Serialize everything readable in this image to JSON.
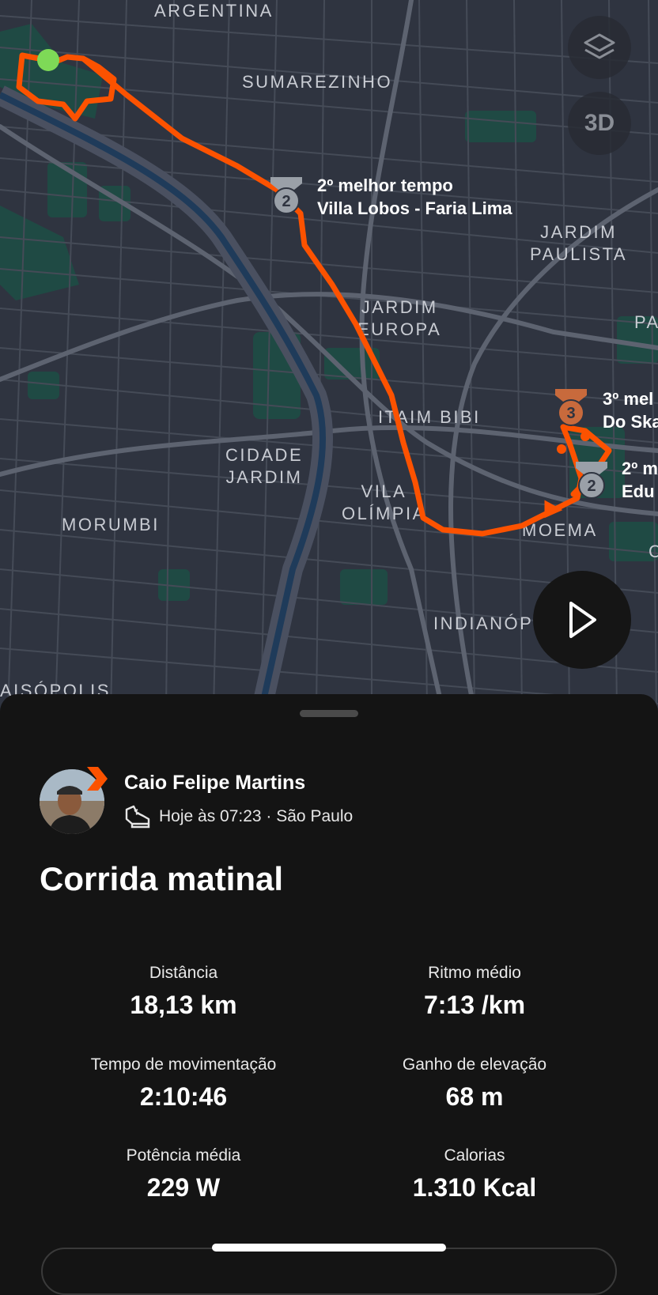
{
  "map": {
    "places": [
      "ARGENTINA",
      "SUMAREZINHO",
      "JARDIM\nPAULISTA",
      "JARDIM\nEUROPA",
      "PA",
      "ITAIM BIBI",
      "CIDADE\nJARDIM",
      "VILA\nOLÍMPIA",
      "MOEMA",
      "MORUMBI",
      "INDIANÓP",
      "AISÓPOLIS",
      "C"
    ],
    "segments": [
      {
        "rank": "2",
        "line1": "2º melhor tempo",
        "line2": "Villa Lobos - Faria Lima"
      },
      {
        "rank": "3",
        "line1": "3º mel",
        "line2": "Do Ska"
      },
      {
        "rank": "2",
        "line1": "2º m",
        "line2": "Edu"
      }
    ],
    "button_3d": "3D",
    "icons": {
      "layers": "layers-icon",
      "play": "play-icon",
      "medal": "medal-icon"
    },
    "colors": {
      "route": "#fc5200",
      "start": "#7ed957",
      "bronze": "#c86a3c",
      "silver": "#9aa0a8"
    }
  },
  "athlete": {
    "name": "Caio Felipe Martins",
    "meta": "Hoje às 07:23 · São Paulo",
    "icon": "running-shoe-icon"
  },
  "activity": {
    "title": "Corrida matinal"
  },
  "stats": [
    {
      "label": "Distância",
      "value": "18,13 km"
    },
    {
      "label": "Ritmo médio",
      "value": "7:13 /km"
    },
    {
      "label": "Tempo de movimentação",
      "value": "2:10:46"
    },
    {
      "label": "Ganho de elevação",
      "value": "68 m"
    },
    {
      "label": "Potência média",
      "value": "229 W"
    },
    {
      "label": "Calorias",
      "value": "1.310 Kcal"
    }
  ]
}
